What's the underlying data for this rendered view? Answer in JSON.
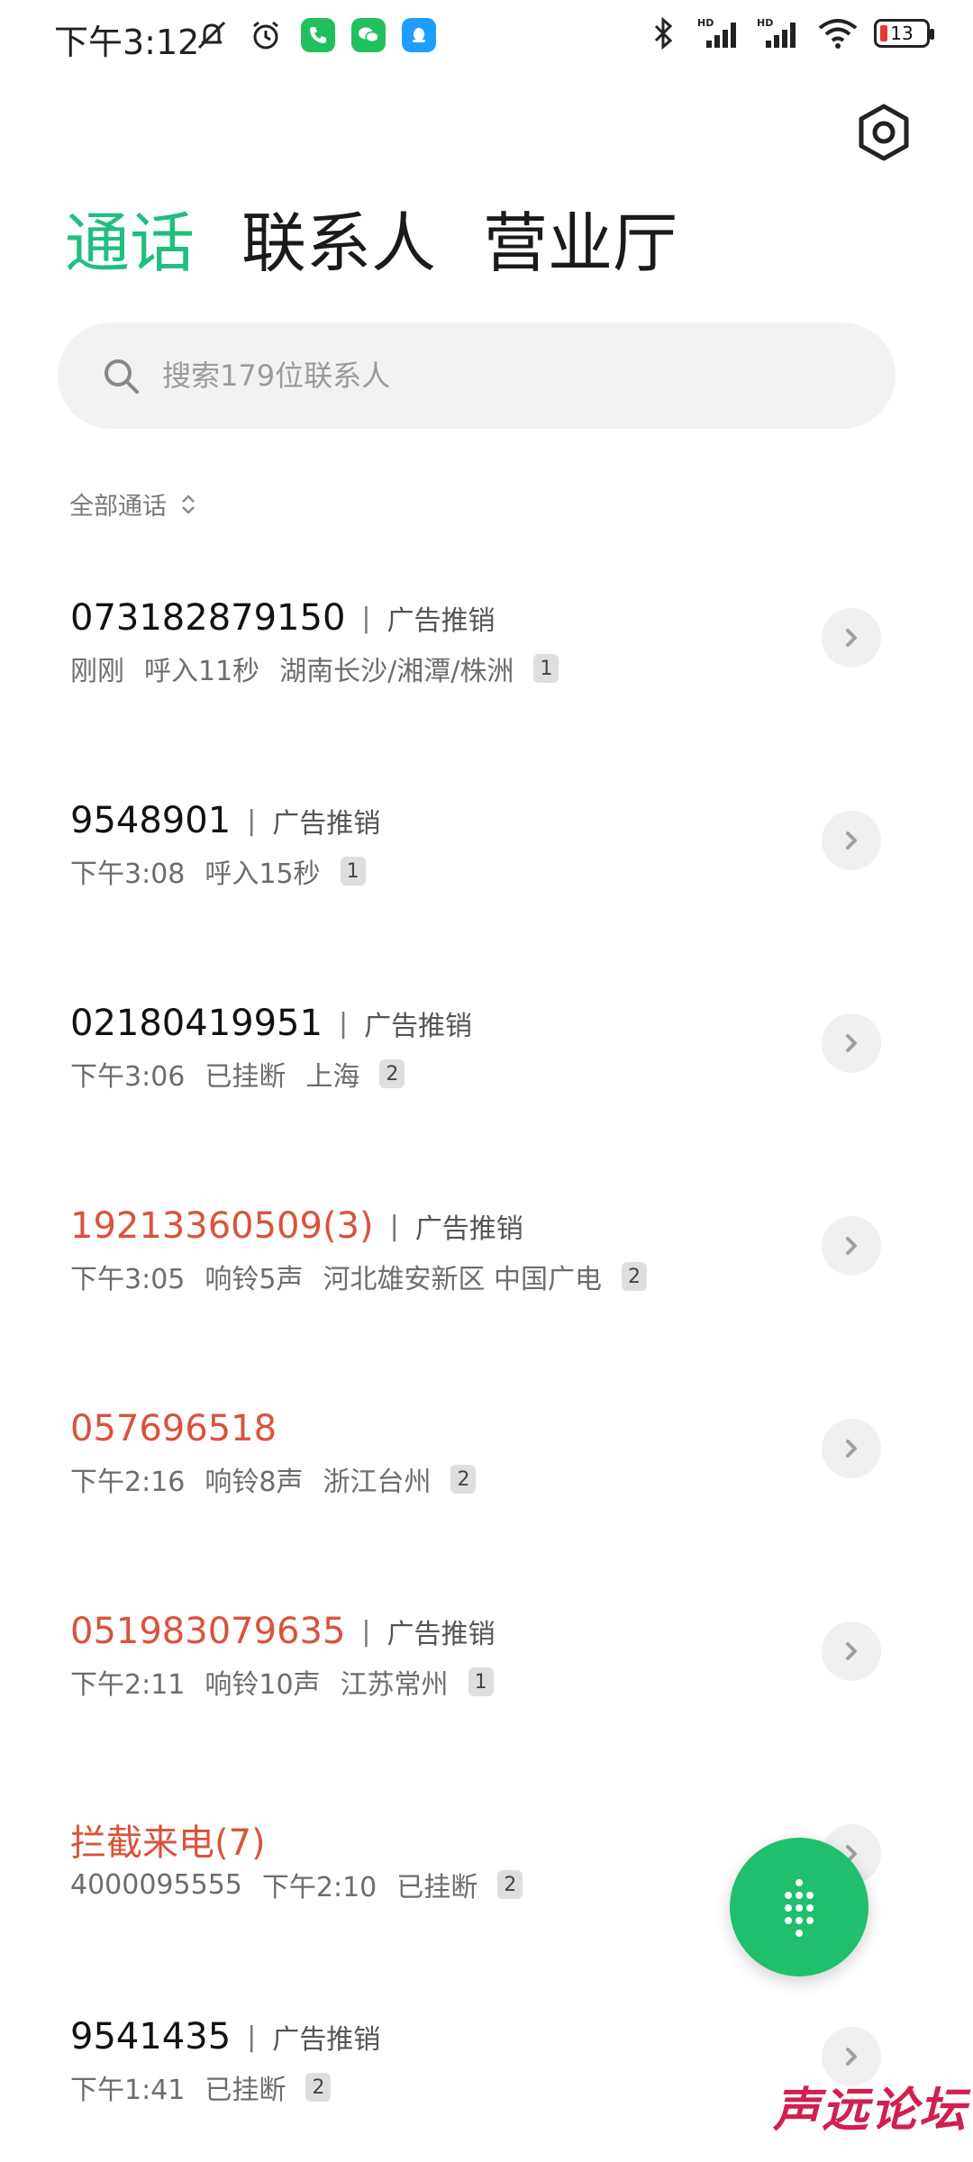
{
  "status_bar": {
    "time": "下午3:12",
    "left_icons": [
      "mute-icon",
      "alarm-icon",
      "phone-app-icon",
      "wechat-icon",
      "qq-icon"
    ],
    "right_icons": [
      "bluetooth-icon",
      "signal-hd-1-icon",
      "signal-hd-2-icon",
      "wifi-icon"
    ],
    "battery_level": "13"
  },
  "tabs": [
    {
      "label": "通话",
      "active": true
    },
    {
      "label": "联系人",
      "active": false
    },
    {
      "label": "营业厅",
      "active": false
    }
  ],
  "search": {
    "placeholder": "搜索179位联系人"
  },
  "filter": {
    "label": "全部通话"
  },
  "calls": [
    {
      "number": "073182879150",
      "tag": "广告推销",
      "time": "刚刚",
      "detail": "呼入11秒",
      "location": "湖南长沙/湘潭/株洲",
      "count": "1",
      "missed": false
    },
    {
      "number": "9548901",
      "tag": "广告推销",
      "time": "下午3:08",
      "detail": "呼入15秒",
      "location": "",
      "count": "1",
      "missed": false
    },
    {
      "number": "02180419951",
      "tag": "广告推销",
      "time": "下午3:06",
      "detail": "已挂断",
      "location": "上海",
      "count": "2",
      "missed": false
    },
    {
      "number": "19213360509(3)",
      "tag": "广告推销",
      "time": "下午3:05",
      "detail": "响铃5声",
      "location": "河北雄安新区 中国广电",
      "count": "2",
      "missed": true
    },
    {
      "number": "057696518",
      "tag": "",
      "time": "下午2:16",
      "detail": "响铃8声",
      "location": "浙江台州",
      "count": "2",
      "missed": true
    },
    {
      "number": "051983079635",
      "tag": "广告推销",
      "time": "下午2:11",
      "detail": "响铃10声",
      "location": "江苏常州",
      "count": "1",
      "missed": true
    },
    {
      "number": "拦截来电(7)",
      "tag": "",
      "time": "4000095555",
      "detail": "下午2:10",
      "location": "已挂断",
      "count": "2",
      "missed": true
    },
    {
      "number": "9541435",
      "tag": "广告推销",
      "time": "下午1:41",
      "detail": "已挂断",
      "location": "",
      "count": "2",
      "missed": false
    }
  ],
  "watermark": "声远论坛",
  "colors": {
    "accent": "#1fbf7c",
    "missed": "#d9533a",
    "fab": "#1fbf6e"
  }
}
